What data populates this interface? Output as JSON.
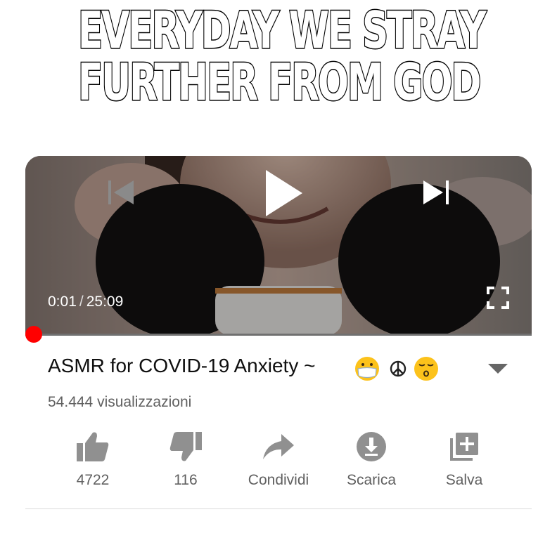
{
  "meme": {
    "line1": "EVERYDAY WE STRAY",
    "line2": "FURTHER FROM GOD"
  },
  "player": {
    "current_time": "0:01",
    "separator": "/",
    "duration": "25:09",
    "progress_fraction": 0.001,
    "icons": [
      "skip-previous-icon",
      "play-icon",
      "skip-next-icon",
      "fullscreen-icon"
    ]
  },
  "video": {
    "title": "ASMR for COVID-19 Anxiety ~",
    "title_emojis": [
      "mask-face-emoji",
      "peace-symbol",
      "kissing-face-emoji"
    ],
    "views": "54.444 visualizzazioni"
  },
  "actions": [
    {
      "label": "4722",
      "icon": "thumbs-up-icon"
    },
    {
      "label": "116",
      "icon": "thumbs-down-icon"
    },
    {
      "label": "Condividi",
      "icon": "share-icon"
    },
    {
      "label": "Scarica",
      "icon": "download-icon"
    },
    {
      "label": "Salva",
      "icon": "save-playlist-icon"
    }
  ],
  "colors": {
    "progress": "#ff0000",
    "icon_gray": "#909090",
    "text_gray": "#606060"
  }
}
